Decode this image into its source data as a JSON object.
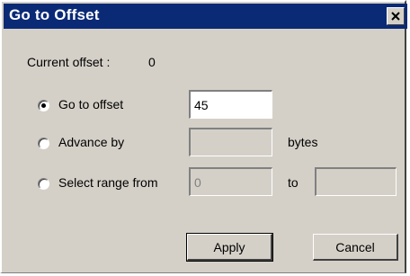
{
  "dialog": {
    "title": "Go to Offset",
    "close_symbol": "×",
    "current_offset_label": "Current offset :",
    "current_offset_value": "0"
  },
  "options": {
    "goto_offset": {
      "label": "Go to offset",
      "checked": true,
      "value": "45"
    },
    "advance_by": {
      "label": "Advance by",
      "checked": false,
      "value": "",
      "unit_label": "bytes"
    },
    "select_range": {
      "label": "Select range from",
      "checked": false,
      "from_value": "0",
      "to_label": "to",
      "to_value": ""
    }
  },
  "buttons": {
    "apply_label": "Apply",
    "cancel_label": "Cancel"
  },
  "colors": {
    "title_bar": "#0a2a76",
    "face": "#d4d0c8"
  }
}
